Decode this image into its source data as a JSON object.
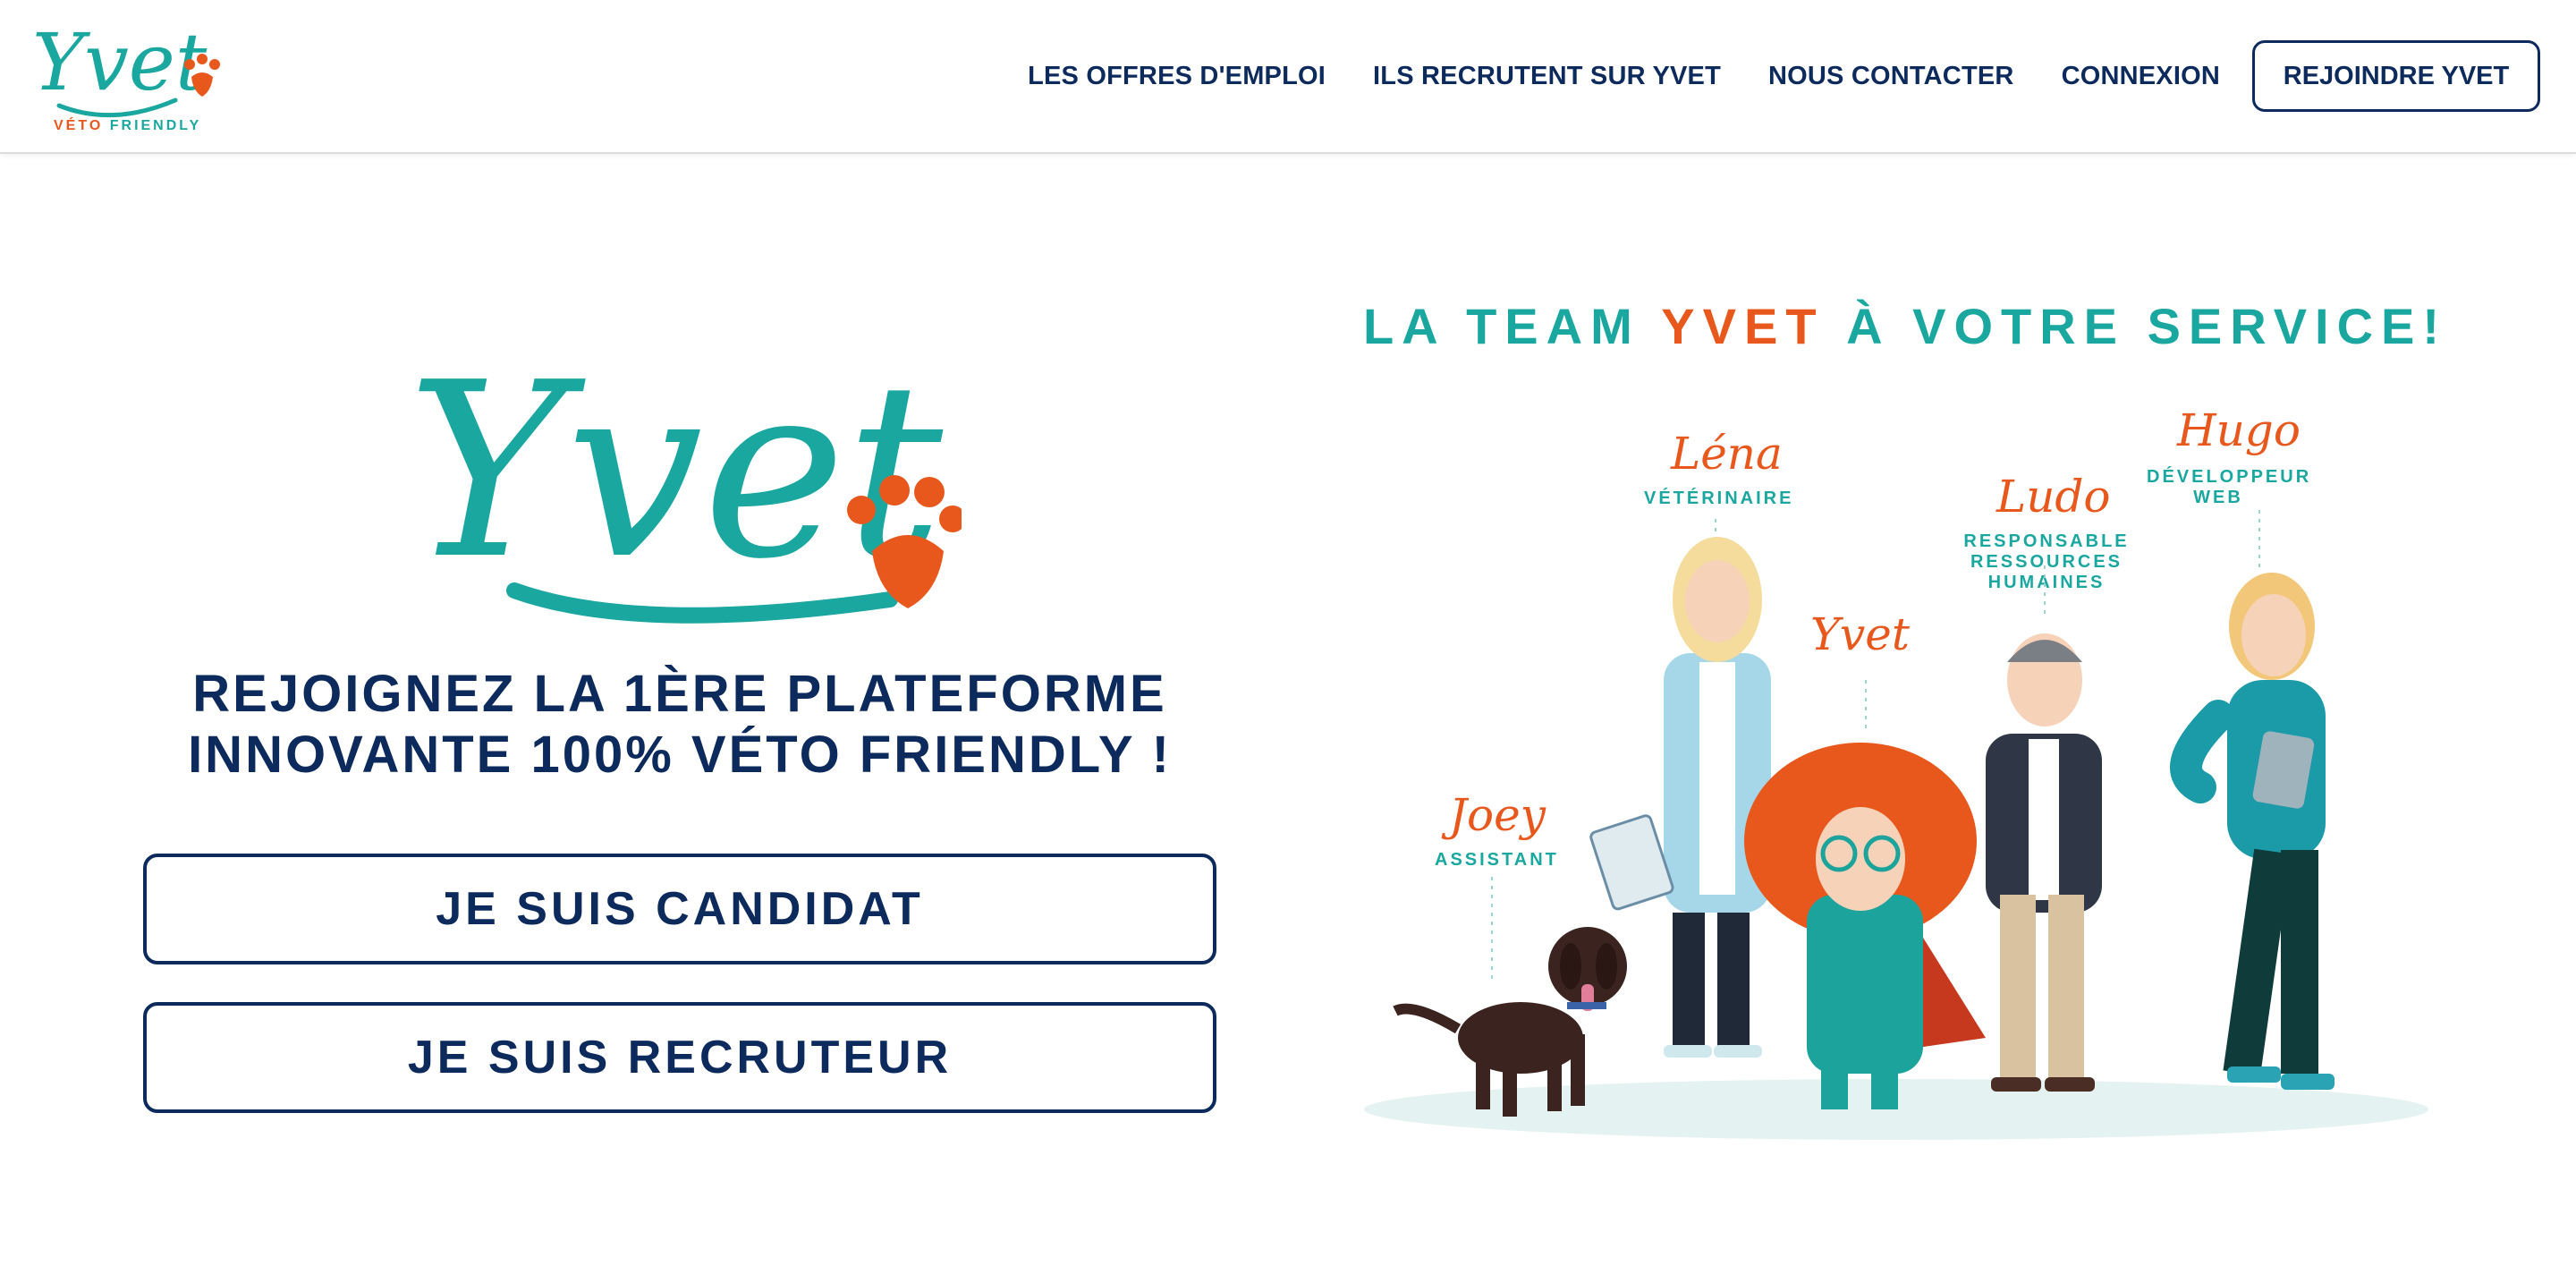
{
  "brand": {
    "name": "Yvet",
    "tagline_veto": "VÉTO",
    "tagline_friendly": "FRIENDLY",
    "colors": {
      "navy": "#0d2a5c",
      "teal": "#1aa7a0",
      "orange": "#e8581c"
    }
  },
  "nav": {
    "items": [
      {
        "label": "LES OFFRES D'EMPLOI"
      },
      {
        "label": "ILS RECRUTENT SUR YVET"
      },
      {
        "label": "NOUS CONTACTER"
      },
      {
        "label": "CONNEXION"
      }
    ],
    "cta": "REJOINDRE YVET"
  },
  "hero": {
    "logo_text": "Yvet",
    "title_line1": "REJOIGNEZ LA 1ÈRE PLATEFORME",
    "title_line2": "INNOVANTE 100% VÉTO FRIENDLY !",
    "buttons": {
      "candidat": "JE SUIS CANDIDAT",
      "recruteur": "JE SUIS RECRUTEUR"
    }
  },
  "team": {
    "title_prefix": "LA TEAM",
    "title_accent": "YVET",
    "title_suffix": "À VOTRE SERVICE!",
    "members": [
      {
        "name": "Léna",
        "role": "VÉTÉRINAIRE"
      },
      {
        "name": "Hugo",
        "role": "DÉVELOPPEUR WEB"
      },
      {
        "name": "Ludo",
        "role": "RESPONSABLE RESSOURCES HUMAINES"
      },
      {
        "name": "Yvet",
        "role": ""
      },
      {
        "name": "Joey",
        "role": "ASSISTANT"
      }
    ]
  }
}
